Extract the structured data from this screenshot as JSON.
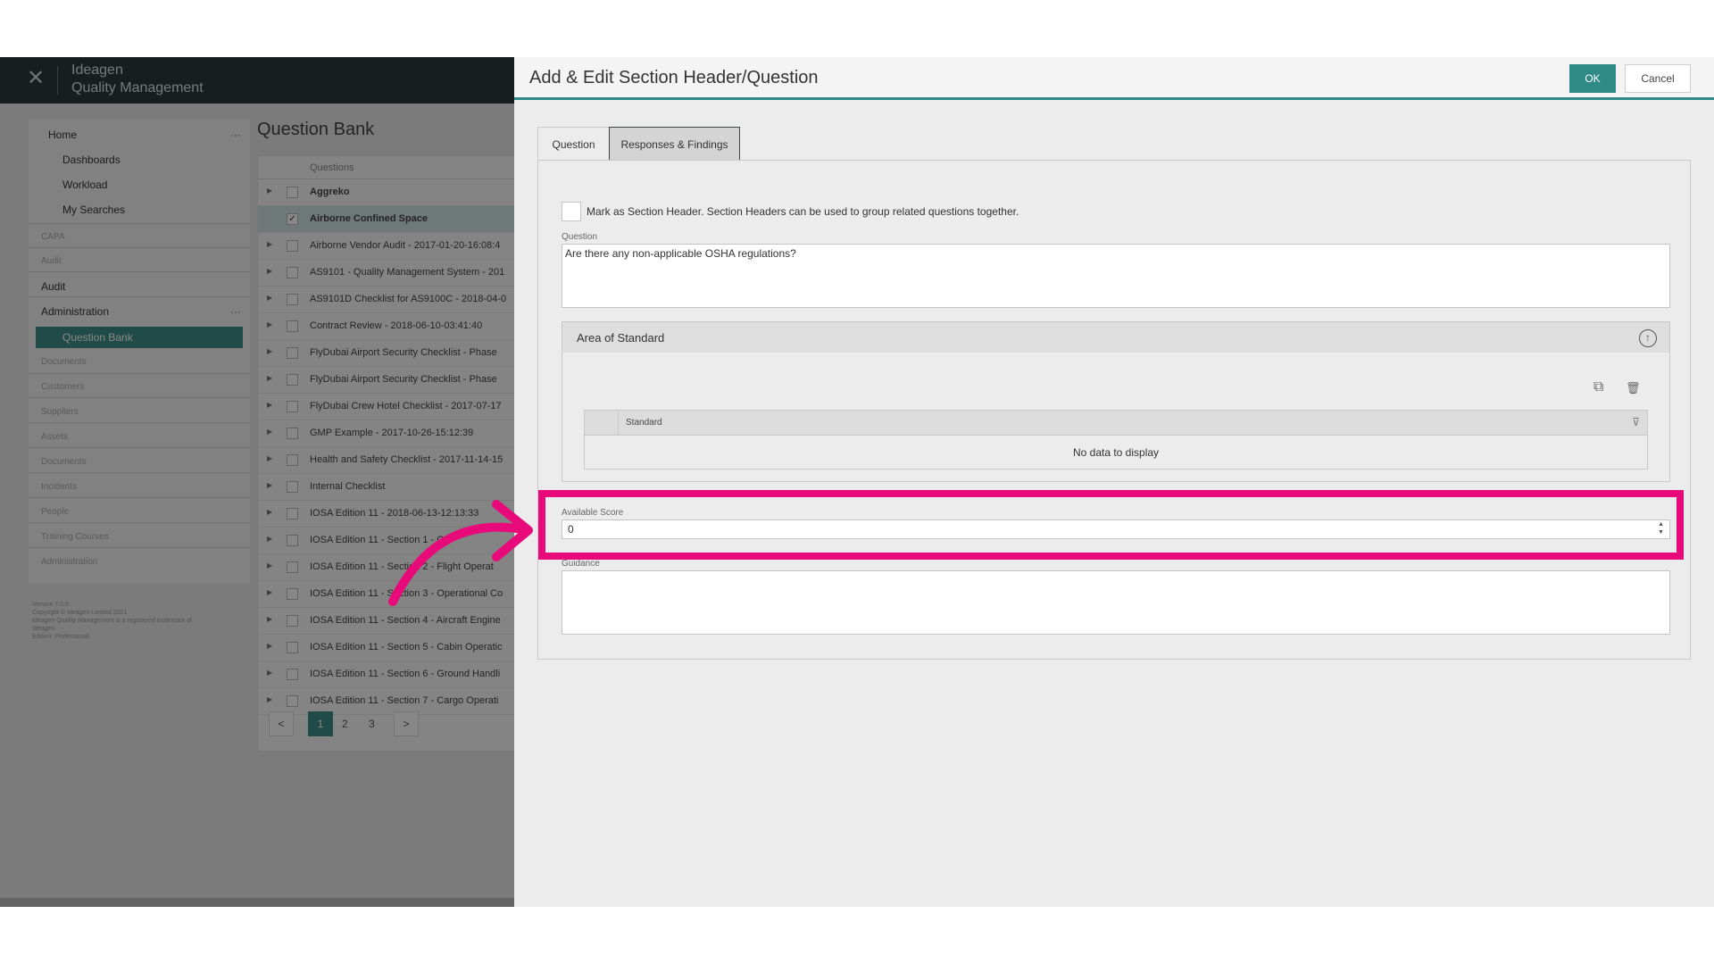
{
  "app": {
    "close_glyph": "✕",
    "brand_line1": "Ideagen",
    "brand_line2": "Quality Management"
  },
  "sidebar": {
    "home": "Home",
    "dashboards": "Dashboards",
    "workload": "Workload",
    "my_searches": "My Searches",
    "capa": "CAPA",
    "audit_dim": "Audit",
    "audit": "Audit",
    "administration": "Administration",
    "question_bank": "Question Bank",
    "documents": "Documents",
    "customers": "Customers",
    "suppliers": "Suppliers",
    "assets": "Assets",
    "documents2": "Documents",
    "incidents": "Incidents",
    "people": "People",
    "training_courses": "Training Courses",
    "administration2": "Administration",
    "more_glyph": "···",
    "footer_line1": "Version 7.0.5",
    "footer_line2": "Copyright © Ideagen Limited 2021",
    "footer_line3": "Ideagen Quality Management is a registered trademark of",
    "footer_line4": "Ideagen",
    "footer_line5": "Edition: Professional"
  },
  "question_bank": {
    "title": "Question Bank",
    "column_header": "Questions",
    "rows": [
      {
        "text": "Aggreko"
      },
      {
        "text": "Airborne Confined Space"
      },
      {
        "text": "Airborne Vendor Audit - 2017-01-20-16:08:4"
      },
      {
        "text": "AS9101 - Quality Management System - 201"
      },
      {
        "text": "AS9101D Checklist for AS9100C - 2018-04-0"
      },
      {
        "text": "Contract Review - 2018-06-10-03:41:40"
      },
      {
        "text": "FlyDubai Airport Security Checklist - Phase"
      },
      {
        "text": "FlyDubai Airport Security Checklist - Phase"
      },
      {
        "text": "FlyDubai Crew Hotel Checklist - 2017-07-17"
      },
      {
        "text": "GMP Example - 2017-10-26-15:12:39"
      },
      {
        "text": "Health and Safety Checklist - 2017-11-14-15"
      },
      {
        "text": "Internal Checklist"
      },
      {
        "text": "IOSA Edition 11 - 2018-06-13-12:13:33"
      },
      {
        "text": "IOSA Edition 11 - Section 1 - Or"
      },
      {
        "text": "IOSA Edition 11 - Section 2 - Flight Operat"
      },
      {
        "text": "IOSA Edition 11 - Section 3 - Operational Co"
      },
      {
        "text": "IOSA Edition 11 - Section 4 - Aircraft Engine"
      },
      {
        "text": "IOSA Edition 11 - Section 5 - Cabin Operatic"
      },
      {
        "text": "IOSA Edition 11 - Section 6 - Ground Handli"
      },
      {
        "text": "IOSA Edition 11 - Section 7 - Cargo Operati"
      }
    ],
    "selected_check": "✓",
    "pager": {
      "prev": "<",
      "p1": "1",
      "p2": "2",
      "p3": "3",
      "next": ">"
    }
  },
  "dialog": {
    "title": "Add & Edit Section Header/Question",
    "ok": "OK",
    "cancel": "Cancel",
    "tabs": [
      "Question",
      "Responses & Findings"
    ],
    "section_header_label": "Mark as Section Header. Section Headers can be used to group related questions together.",
    "question_label": "Question",
    "question_value": "Are there any non-applicable OSHA regulations?",
    "area_of_standard": {
      "title": "Area of Standard",
      "collapse_glyph": "↑",
      "copy_glyph": "⧉",
      "delete_glyph": "🗑",
      "column": "Standard",
      "filter_glyph": "⊽",
      "empty": "No data to display"
    },
    "available_score_label": "Available Score",
    "available_score_value": "0",
    "spin_up": "▲",
    "spin_down": "▼",
    "guidance_label": "Guidance",
    "guidance_value": ""
  },
  "colors": {
    "accent": "#2f8a86",
    "highlight": "#e8097a",
    "overlay": "rgba(0,0,0,0.47)"
  },
  "icons": [
    "close-icon",
    "more-icon",
    "checkbox-icon",
    "collapse-up-icon",
    "copy-icon",
    "delete-icon",
    "filter-icon",
    "spin-up-icon",
    "spin-down-icon",
    "annotation-arrow-icon"
  ]
}
